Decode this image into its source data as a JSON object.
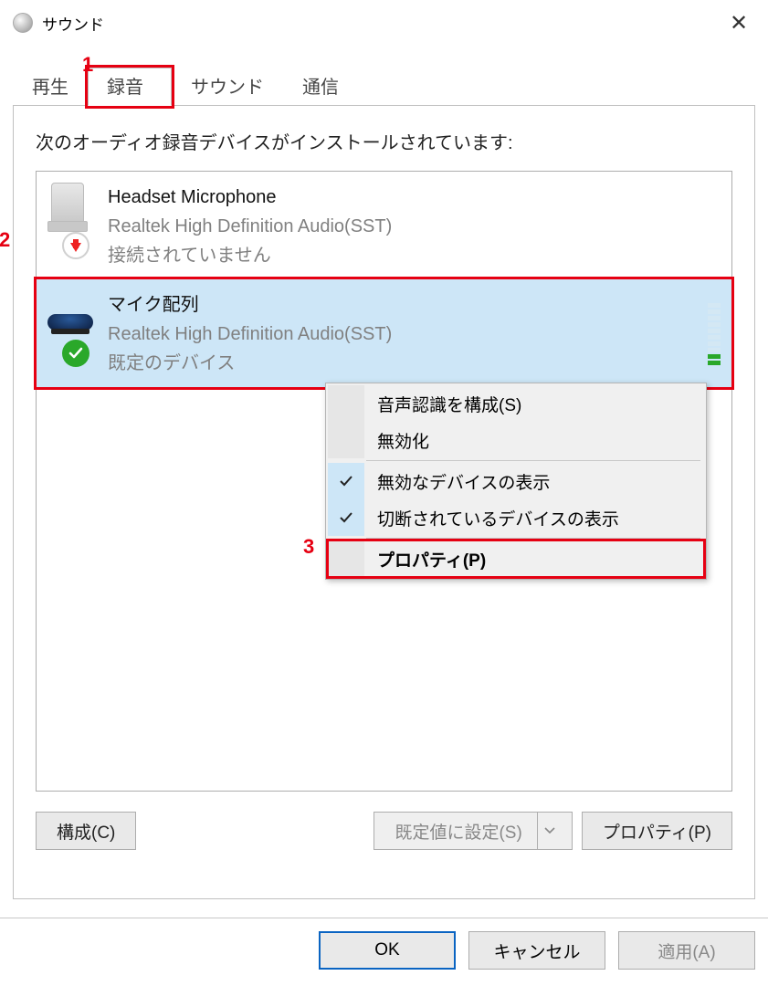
{
  "window": {
    "title": "サウンド"
  },
  "tabs": {
    "playback": "再生",
    "recording": "録音",
    "sound": "サウンド",
    "communications": "通信",
    "active": "recording"
  },
  "instruction_text": "次のオーディオ録音デバイスがインストールされています:",
  "devices": [
    {
      "name": "Headset Microphone",
      "driver": "Realtek High Definition Audio(SST)",
      "status": "接続されていません",
      "selected": false,
      "badge": "disconnected"
    },
    {
      "name": "マイク配列",
      "driver": "Realtek High Definition Audio(SST)",
      "status": "既定のデバイス",
      "selected": true,
      "badge": "default"
    }
  ],
  "context_menu": {
    "items": [
      {
        "label": "音声認識を構成(S)",
        "checked": false
      },
      {
        "label": "無効化",
        "checked": false
      }
    ],
    "separator1": true,
    "toggle_items": [
      {
        "label": "無効なデバイスの表示",
        "checked": true
      },
      {
        "label": "切断されているデバイスの表示",
        "checked": true
      }
    ],
    "separator2": true,
    "properties": "プロパティ(P)"
  },
  "buttons": {
    "configure": "構成(C)",
    "set_default": "既定値に設定(S)",
    "properties": "プロパティ(P)",
    "ok": "OK",
    "cancel": "キャンセル",
    "apply": "適用(A)"
  },
  "annotations": {
    "a1": "1",
    "a2": "2",
    "a3": "3"
  }
}
